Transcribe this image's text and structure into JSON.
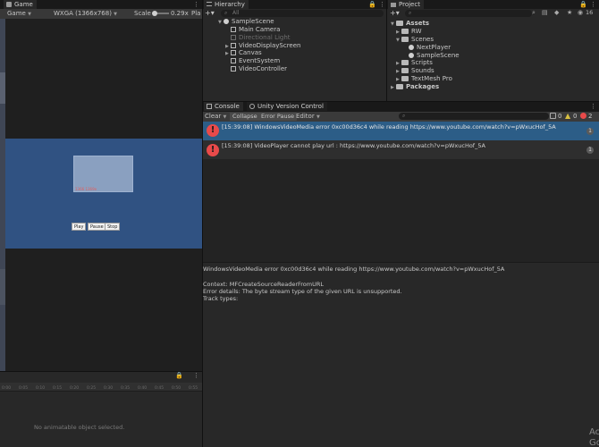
{
  "game": {
    "tab": "Game",
    "display": "Game",
    "resolution": "WXGA (1366x768)",
    "scale_label": "Scale",
    "scale_value": "0.29x",
    "play_label": "Pla",
    "buttons": [
      "Play",
      "Pause",
      "Stop"
    ],
    "video_text": "1366 1369e"
  },
  "hierarchy": {
    "tab": "Hierarchy",
    "search_placeholder": "All",
    "items": [
      "SampleScene",
      "Main Camera",
      "Directional Light",
      "VideoDisplayScreen",
      "Canvas",
      "EventSystem",
      "VideoController"
    ]
  },
  "project": {
    "tab": "Project",
    "count": "16",
    "items": [
      "Assets",
      "RW",
      "Scenes",
      "NextPlayer",
      "SampleScene",
      "Scripts",
      "Sounds",
      "TextMesh Pro",
      "Packages"
    ]
  },
  "console": {
    "tabs": [
      "Console",
      "Unity Version Control"
    ],
    "toolbar": [
      "Clear",
      "Collapse",
      "Error Pause",
      "Editor"
    ],
    "counts": {
      "logs": "0",
      "warnings": "0",
      "errors": "2"
    },
    "entries": [
      {
        "text": "[15:39:08] WindowsVideoMedia error 0xc00d36c4 while reading https://www.youtube.com/watch?v=pWxucHof_5A",
        "count": "1"
      },
      {
        "text": "[15:39:08] VideoPlayer cannot play url : https://www.youtube.com/watch?v=pWxucHof_5A",
        "count": "1"
      }
    ],
    "detail": [
      "WindowsVideoMedia error 0xc00d36c4 while reading https://www.youtube.com/watch?v=pWxucHof_5A",
      "Context: MFCreateSourceReaderFromURL",
      "Error details: The byte stream type of the given URL is unsupported.",
      "Track types:"
    ]
  },
  "animation": {
    "empty_text": "No animatable object selected.",
    "ticks": [
      "0:00",
      "0:05",
      "0:10",
      "0:15",
      "0:20",
      "0:25",
      "0:30",
      "0:35",
      "0:40",
      "0:45",
      "0:50",
      "0:55"
    ]
  },
  "overlay": {
    "line1": "Ac",
    "line2": "Go"
  }
}
